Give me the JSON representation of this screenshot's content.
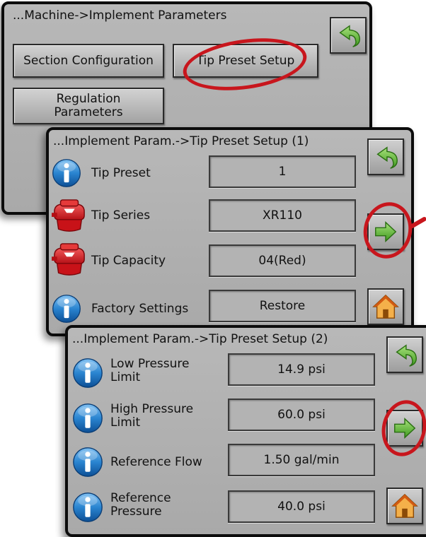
{
  "panel1": {
    "breadcrumb": "...Machine->Implement Parameters",
    "buttons": {
      "section_configuration": "Section Configuration",
      "tip_preset_setup": "Tip Preset Setup",
      "regulation_parameters_line1": "Regulation",
      "regulation_parameters_line2": "Parameters"
    }
  },
  "panel2": {
    "breadcrumb": "...Implement Param.->Tip Preset Setup (1)",
    "rows": [
      {
        "label": "Tip Preset",
        "value": "1",
        "icon": "info-icon"
      },
      {
        "label": "Tip Series",
        "value": "XR110",
        "icon": "spray-tip-icon"
      },
      {
        "label": "Tip Capacity",
        "value": "04(Red)",
        "icon": "spray-tip-icon"
      },
      {
        "label": "Factory Settings",
        "value": "Restore",
        "icon": "info-icon"
      }
    ]
  },
  "panel3": {
    "breadcrumb": "...Implement Param.->Tip Preset Setup (2)",
    "rows": [
      {
        "label_line1": "Low Pressure",
        "label_line2": "Limit",
        "value": "14.9 psi",
        "icon": "info-icon"
      },
      {
        "label_line1": "High Pressure",
        "label_line2": "Limit",
        "value": "60.0 psi",
        "icon": "info-icon"
      },
      {
        "label_line1": "Reference Flow",
        "label_line2": "",
        "value": "1.50 gal/min",
        "icon": "info-icon"
      },
      {
        "label_line1": "Reference",
        "label_line2": "Pressure",
        "value": "40.0 psi",
        "icon": "info-icon"
      }
    ]
  },
  "icons": {
    "back": "back-arrow-icon",
    "next": "next-arrow-icon",
    "home": "home-icon",
    "info": "info-icon",
    "tip": "spray-tip-icon"
  },
  "colors": {
    "panel_bg": "#b0b0b0",
    "highlight_ring": "#c8161d",
    "info_blue": "#1f78c8",
    "tip_red": "#d8141c",
    "arrow_green": "#5ab52e",
    "home_orange": "#e9871d"
  }
}
